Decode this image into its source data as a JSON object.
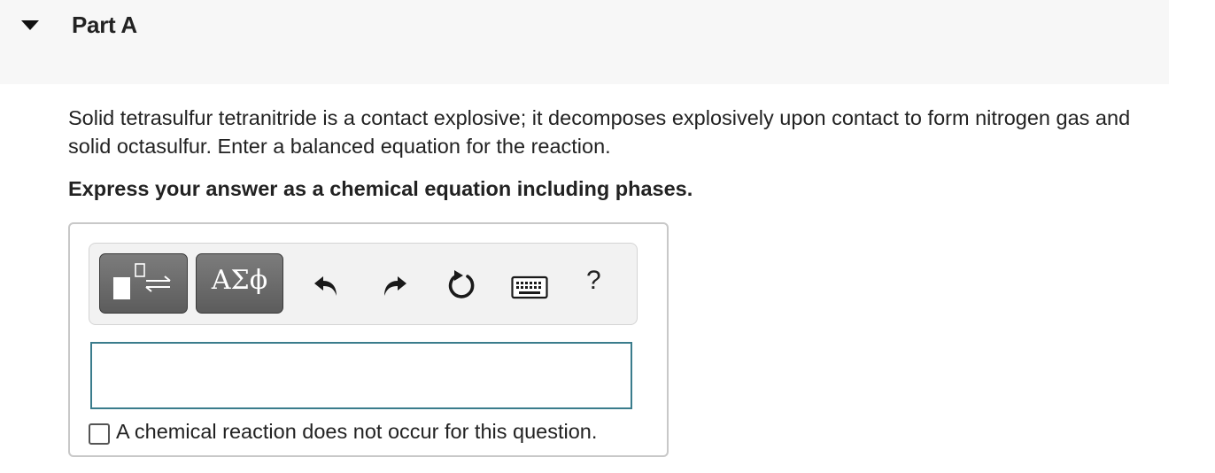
{
  "part": {
    "title": "Part A",
    "toggle_icon": "triangle-down-icon"
  },
  "question": {
    "text": "Solid tetrasulfur tetranitride is a contact explosive; it decomposes explosively upon contact to form nitrogen gas and solid octasulfur. Enter a balanced equation for the reaction.",
    "instruction": "Express your answer as a chemical equation including phases."
  },
  "toolbar": {
    "templates_icon": "templates-icon",
    "symbols_label": "ΑΣϕ",
    "undo_icon": "undo-icon",
    "redo_icon": "redo-icon",
    "reset_icon": "reset-icon",
    "keyboard_icon": "keyboard-icon",
    "help_label": "?"
  },
  "answer": {
    "value": "",
    "no_reaction_checked": false,
    "no_reaction_label": "A chemical reaction does not occur for this question."
  },
  "colors": {
    "header_bg": "#f7f7f7",
    "button_gray": "#6b6b6b",
    "input_border": "#3a7c8c",
    "text": "#222222"
  }
}
